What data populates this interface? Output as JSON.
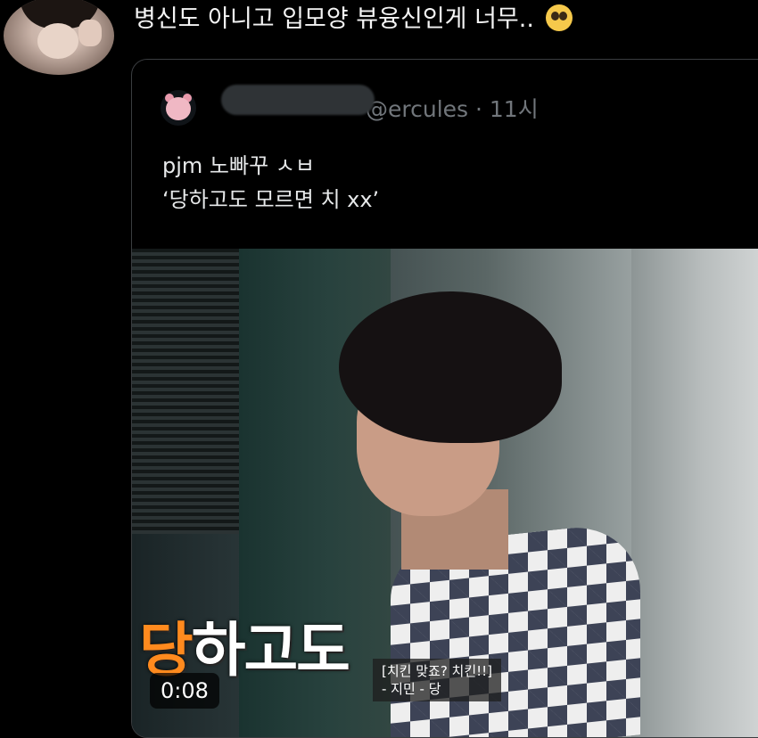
{
  "reply": {
    "text": "병신도 아니고 입모양 뷰융신인게 너무..",
    "emoji": "pleading-face-emoji"
  },
  "quoted_tweet": {
    "handle": "@ercules",
    "time": "11시",
    "body_line1": "pjm 노빠꾸 ㅅㅂ",
    "body_line2": "‘당하고도 모르면 치 xx’"
  },
  "video": {
    "caption_highlight": "당",
    "caption_rest": "하고도",
    "subtitle": "[치킨 맞죠? 치킨!!]\n- 지민 - 당",
    "duration": "0:08",
    "highlight_color": "#ff8a1e"
  }
}
